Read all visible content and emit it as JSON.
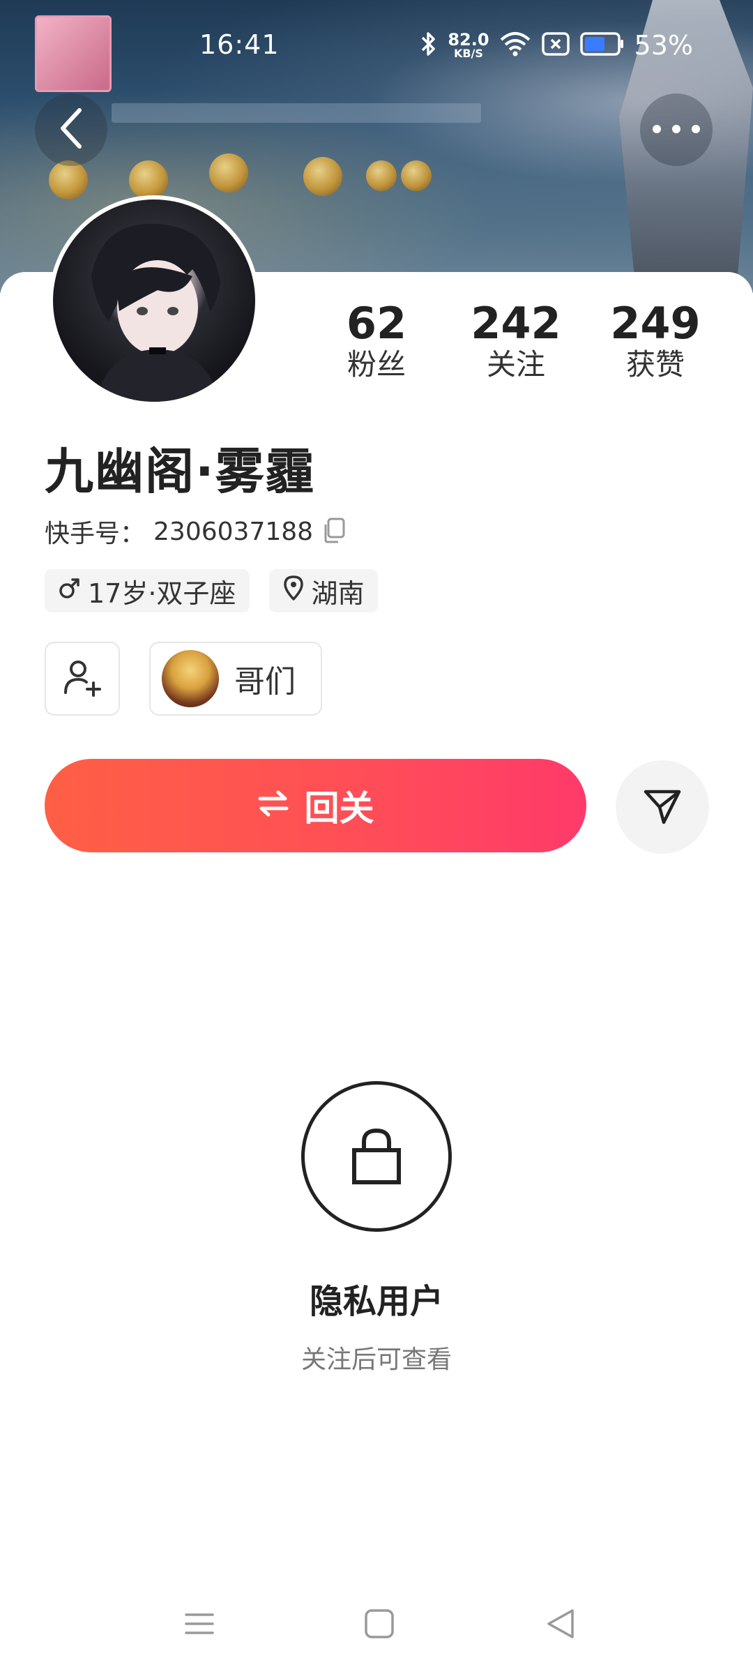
{
  "status_bar": {
    "time": "16:41",
    "net_speed_value": "82.0",
    "net_speed_unit": "KB/S",
    "battery": "53%"
  },
  "profile": {
    "stats": [
      {
        "value": "62",
        "label": "粉丝"
      },
      {
        "value": "242",
        "label": "关注"
      },
      {
        "value": "249",
        "label": "获赞"
      }
    ],
    "name": "九幽阁·雾霾",
    "kid_label": "快手号：",
    "kid_value": "2306037188",
    "tags": {
      "age_zodiac": "17岁·双子座",
      "location": "湖南"
    },
    "group_label": "哥们",
    "follow_button": "回关"
  },
  "privacy": {
    "title": "隐私用户",
    "subtitle": "关注后可查看"
  },
  "colors": {
    "follow_gradient_start": "#ff5f45",
    "follow_gradient_end": "#ff3a6a",
    "text_primary": "#222222",
    "text_secondary": "#777777"
  }
}
